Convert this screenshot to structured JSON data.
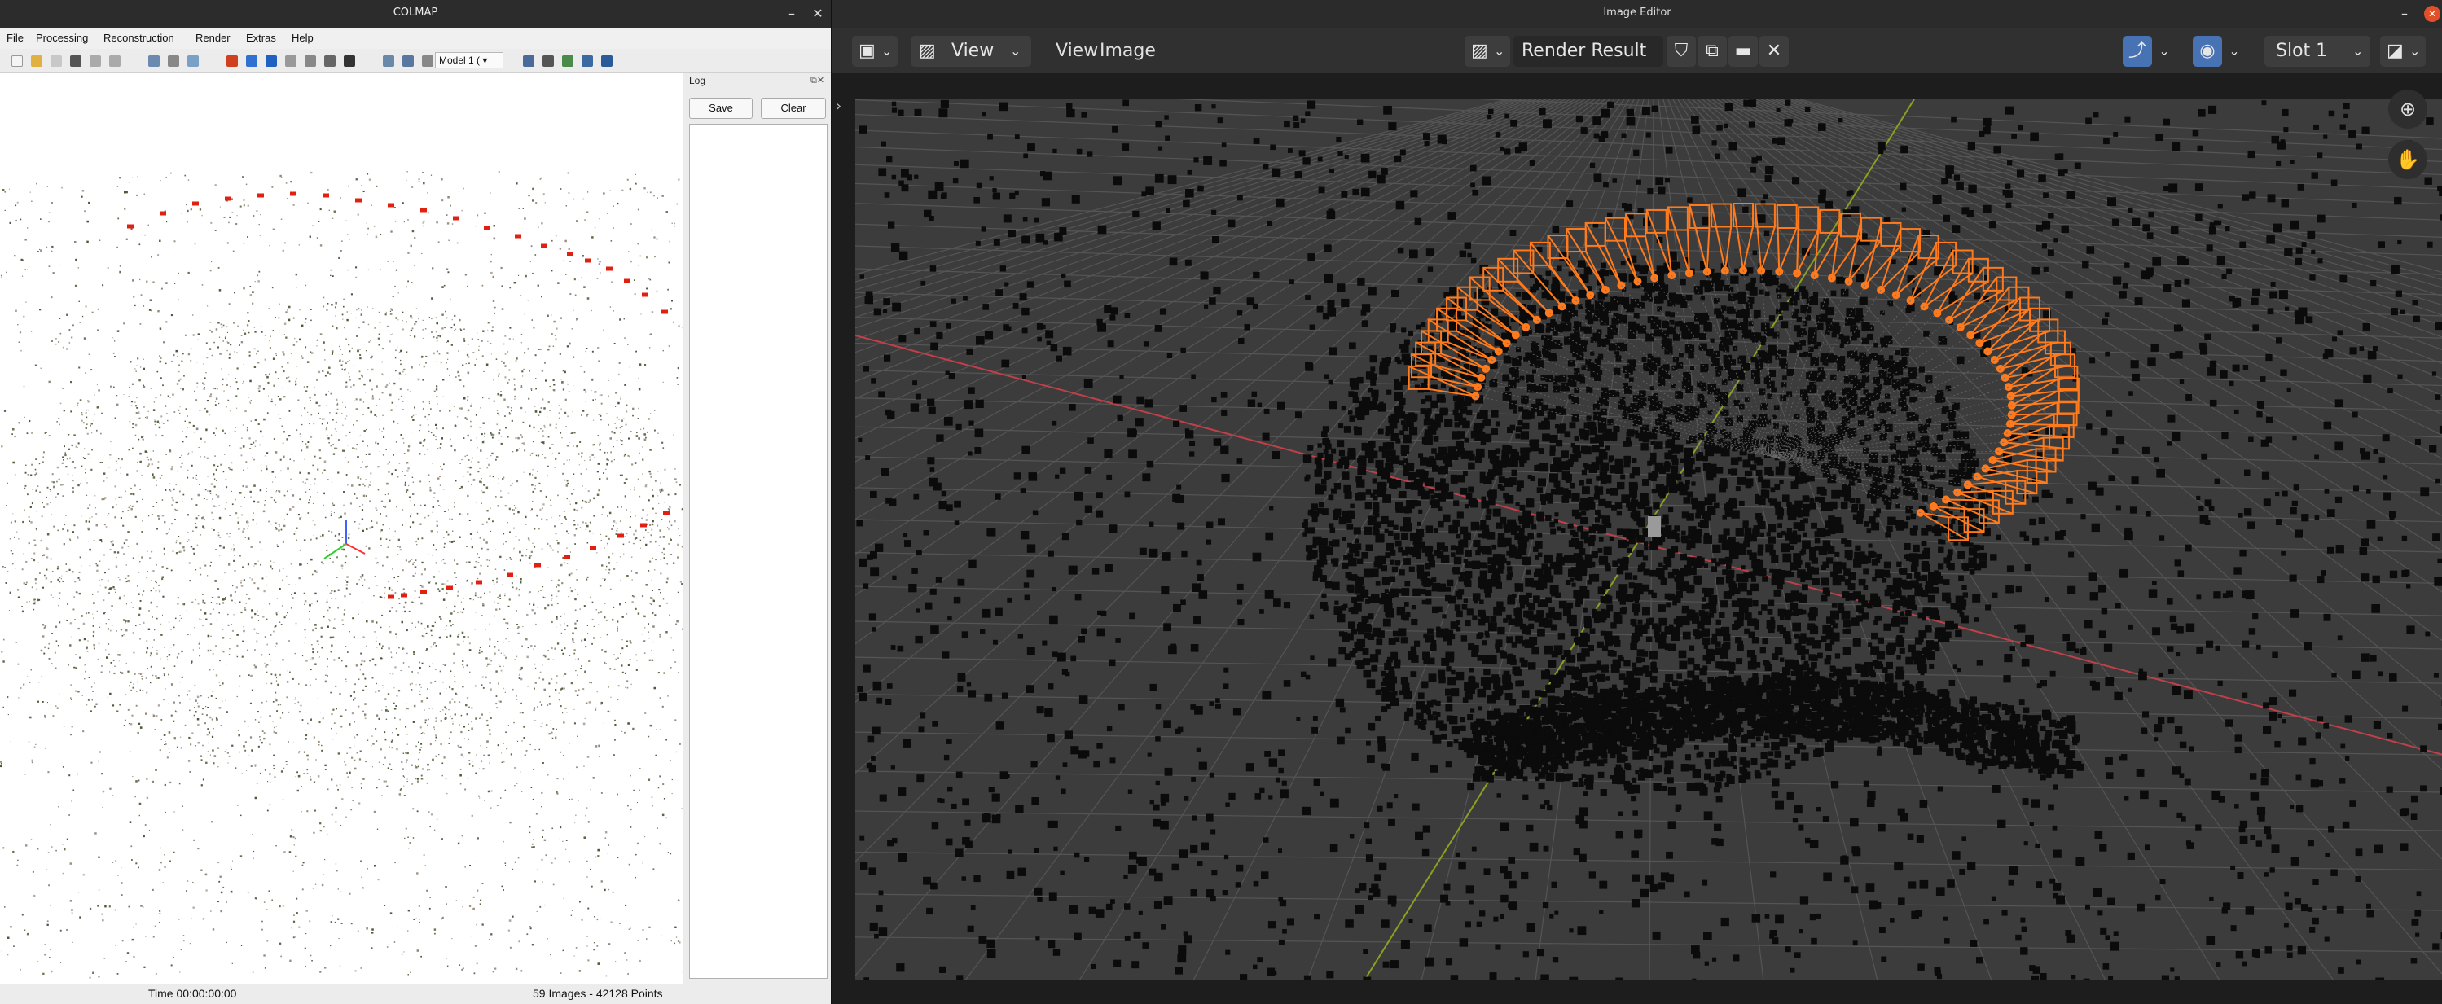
{
  "colmap": {
    "title": "COLMAP",
    "window_controls": {
      "minimize": "–",
      "close": "✕"
    },
    "menu": [
      "File",
      "Processing",
      "Reconstruction",
      "Render",
      "Extras",
      "Help"
    ],
    "model_select": "Model 1 (",
    "log": {
      "title": "Log",
      "save": "Save",
      "clear": "Clear"
    },
    "status": {
      "time": "Time 00:00:00:00",
      "summary": "59 Images - 42128 Points"
    }
  },
  "blender": {
    "title": "Image Editor",
    "window_controls": {
      "minimize": "–",
      "close": "✕"
    },
    "header": {
      "view_dropdown": "View",
      "menu_view": "View",
      "menu_image": "Image",
      "image_name": "Render Result",
      "slot": "Slot 1"
    }
  },
  "colors": {
    "camera_red": "#e02010",
    "blender_orange": "#ff7a1c",
    "axis_red": "#c0404a",
    "axis_green": "#8aa020",
    "grid": "#555555"
  }
}
